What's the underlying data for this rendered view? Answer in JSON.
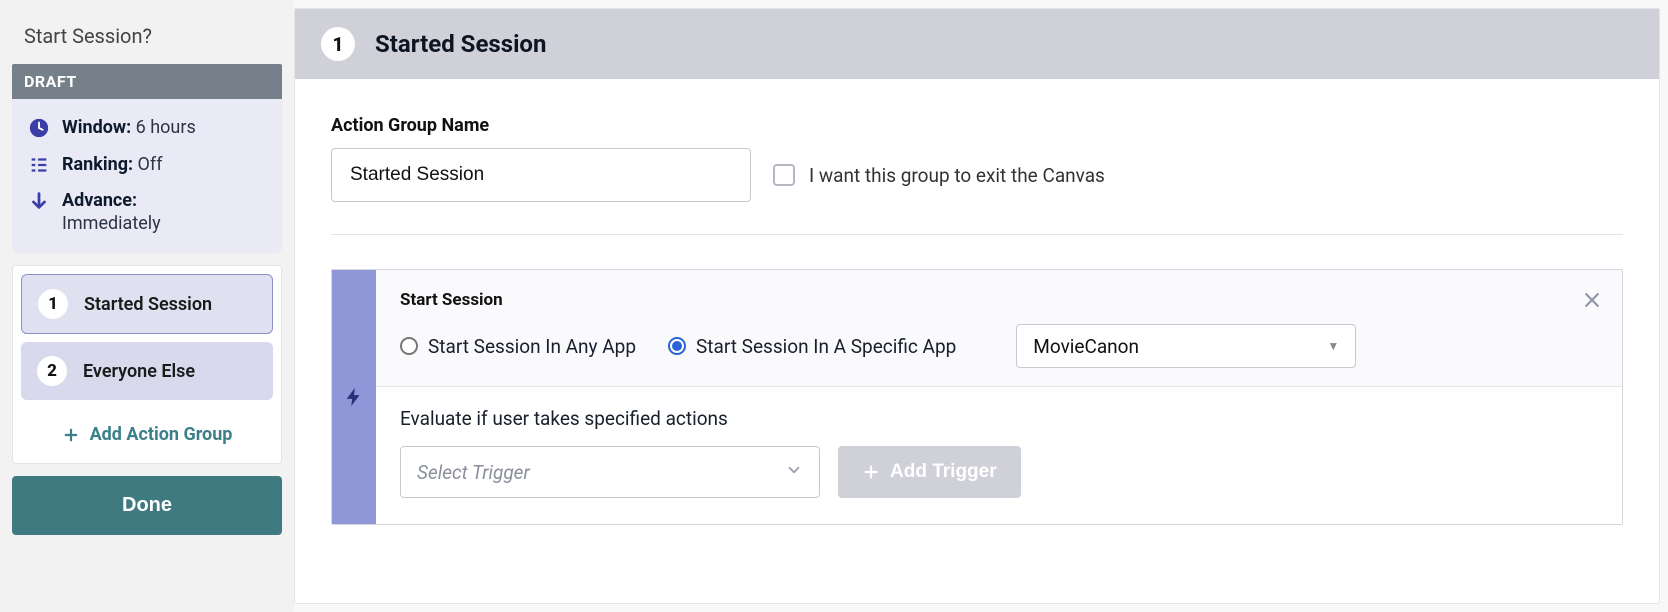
{
  "sidebar": {
    "title": "Start Session?",
    "draft_label": "DRAFT",
    "info": {
      "window_label": "Window:",
      "window_value": "6 hours",
      "ranking_label": "Ranking:",
      "ranking_value": "Off",
      "advance_label": "Advance:",
      "advance_value": "Immediately"
    },
    "groups": [
      {
        "num": "1",
        "label": "Started Session"
      },
      {
        "num": "2",
        "label": "Everyone Else"
      }
    ],
    "add_group_label": "Add Action Group",
    "done_label": "Done"
  },
  "main": {
    "header_num": "1",
    "header_title": "Started Session",
    "name_field_label": "Action Group Name",
    "name_value": "Started Session",
    "exit_checkbox_label": "I want this group to exit the Canvas",
    "action": {
      "subtitle": "Start Session",
      "radio_any": "Start Session In Any App",
      "radio_specific": "Start Session In A Specific App",
      "app_selected": "MovieCanon",
      "evaluate_text": "Evaluate if user takes specified actions",
      "trigger_placeholder": "Select Trigger",
      "add_trigger_label": "Add Trigger"
    }
  }
}
